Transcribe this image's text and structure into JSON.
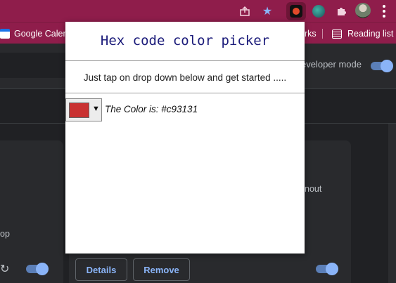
{
  "browser": {
    "bookmarks": [
      {
        "label": "Google Calend"
      },
      {
        "label": "rks"
      },
      {
        "label": "Reading list"
      }
    ],
    "icons": [
      "share-icon",
      "star-icon",
      "extension-active-icon",
      "extension-icon",
      "puzzle-icon",
      "avatar",
      "kebab-menu-icon"
    ]
  },
  "extensions_page": {
    "developer_mode_label": "eveloper mode",
    "card_fragment_right": "nout",
    "card_fragment_left": "op",
    "details_button": "Details",
    "remove_button": "Remove"
  },
  "popup": {
    "title": "Hex code color picker",
    "subtitle": "Just tap on drop down below and get started .....",
    "color_label": "The Color is: #c93131",
    "selected_color": "#c93131"
  },
  "colors": {
    "chrome_toolbar": "#8f1d4b",
    "page_background": "#202124",
    "accent_blue": "#8ab4f8"
  }
}
